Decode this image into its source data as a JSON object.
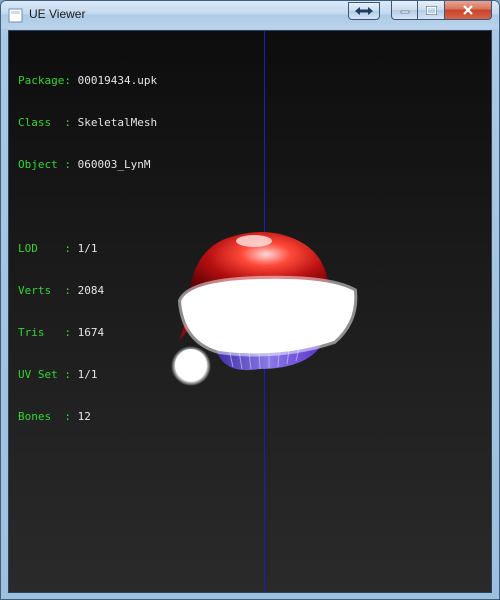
{
  "window": {
    "title": "UE Viewer",
    "icon": "app-icon"
  },
  "titlebar_buttons": {
    "swap": "swap-arrows-icon",
    "minimize": "minimize-icon",
    "maximize": "maximize-icon",
    "close": "close-icon"
  },
  "info": {
    "package": {
      "label": "Package:",
      "value": "00019434.upk"
    },
    "class": {
      "label": "Class  :",
      "value": "SkeletalMesh"
    },
    "object": {
      "label": "Object :",
      "value": "060003_LynM"
    },
    "lod": {
      "label": "LOD    :",
      "value": "1/1"
    },
    "verts": {
      "label": "Verts  :",
      "value": "2084"
    },
    "tris": {
      "label": "Tris   :",
      "value": "1674"
    },
    "uvset": {
      "label": "UV Set :",
      "value": "1/1"
    },
    "bones": {
      "label": "Bones  :",
      "value": "12"
    }
  },
  "colors": {
    "label_green": "#33d633",
    "value_white": "#e6e6e6",
    "axis_blue": "#1b1bc8"
  }
}
